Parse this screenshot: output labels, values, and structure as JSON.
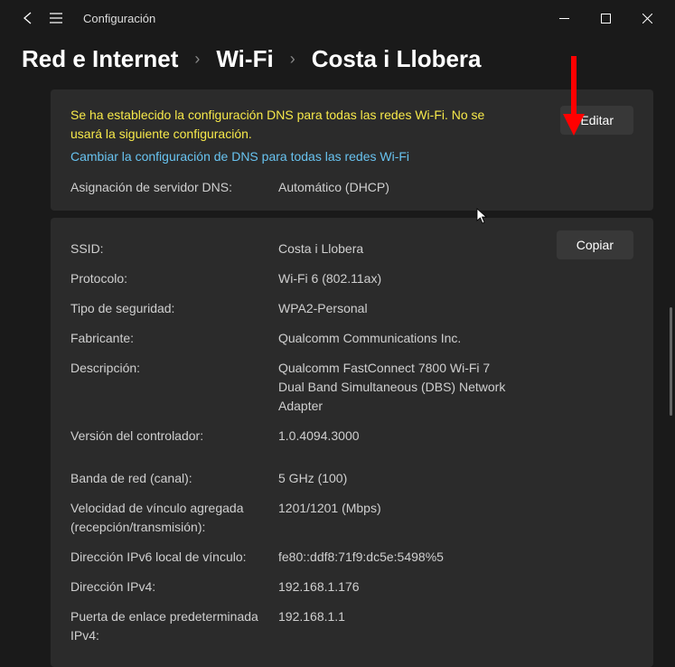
{
  "app": {
    "title": "Configuración"
  },
  "breadcrumb": {
    "item1": "Red e Internet",
    "item2": "Wi-Fi",
    "item3": "Costa i Llobera"
  },
  "dns": {
    "notice": "Se ha establecido la configuración DNS para todas las redes Wi-Fi. No se usará la siguiente configuración.",
    "link": "Cambiar la configuración de DNS para todas las redes Wi-Fi",
    "editLabel": "Editar",
    "assignLabel": "Asignación de servidor DNS:",
    "assignValue": "Automático (DHCP)"
  },
  "copyLabel": "Copiar",
  "props": {
    "ssid": {
      "label": "SSID:",
      "value": "Costa i Llobera"
    },
    "protocol": {
      "label": "Protocolo:",
      "value": "Wi-Fi 6 (802.11ax)"
    },
    "security": {
      "label": "Tipo de seguridad:",
      "value": "WPA2-Personal"
    },
    "manufacturer": {
      "label": "Fabricante:",
      "value": "Qualcomm Communications Inc."
    },
    "description": {
      "label": "Descripción:",
      "value": "Qualcomm FastConnect 7800 Wi-Fi 7 Dual Band Simultaneous (DBS) Network Adapter"
    },
    "driverVersion": {
      "label": "Versión del controlador:",
      "value": "1.0.4094.3000"
    },
    "band": {
      "label": "Banda de red (canal):",
      "value": "5 GHz (100)"
    },
    "linkSpeed": {
      "label": "Velocidad de vínculo agregada (recepción/transmisión):",
      "value": "1201/1201 (Mbps)"
    },
    "ipv6local": {
      "label": "Dirección IPv6 local de vínculo:",
      "value": "fe80::ddf8:71f9:dc5e:5498%5"
    },
    "ipv4": {
      "label": "Dirección IPv4:",
      "value": "192.168.1.176"
    },
    "gateway": {
      "label": "Puerta de enlace predeterminada IPv4:",
      "value": "192.168.1.1"
    }
  }
}
